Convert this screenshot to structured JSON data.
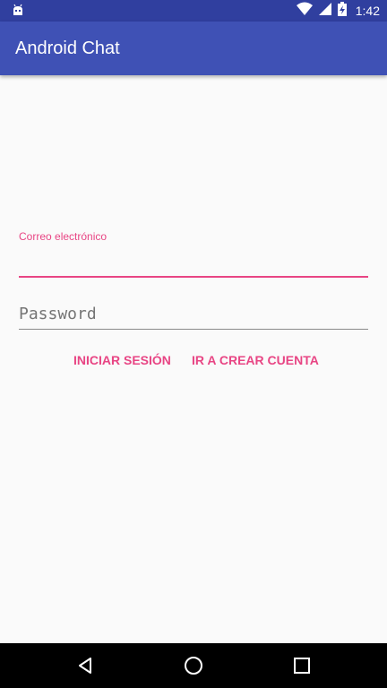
{
  "status_bar": {
    "time": "1:42",
    "icons": [
      "android-notification-icon",
      "wifi-icon",
      "signal-icon",
      "battery-charging-icon"
    ]
  },
  "app_bar": {
    "title": "Android Chat"
  },
  "form": {
    "email_label": "Correo electrónico",
    "email_value": "",
    "password_placeholder": "Password",
    "password_value": ""
  },
  "actions": {
    "login_label": "INICIAR SESIÓN",
    "create_account_label": "IR A CREAR CUENTA"
  },
  "navigation": {
    "icons": [
      "back-icon",
      "home-icon",
      "recents-icon"
    ]
  },
  "colors": {
    "status_bar": "#303f9f",
    "primary": "#3f51b5",
    "accent": "#e84584",
    "background": "#fafafa"
  }
}
